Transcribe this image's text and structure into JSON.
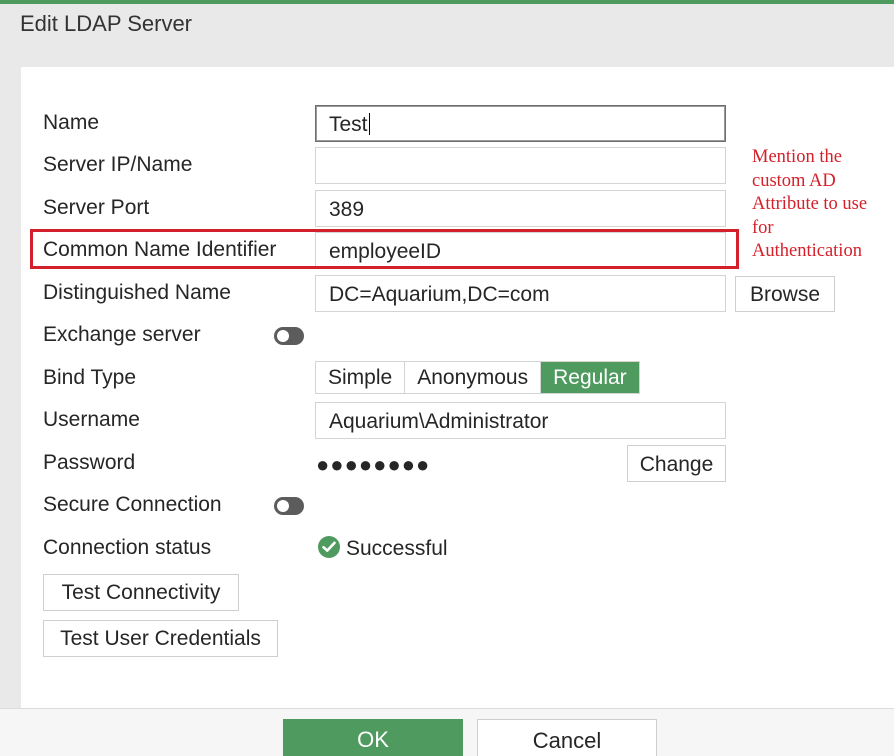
{
  "dialog": {
    "title": "Edit LDAP Server"
  },
  "fields": {
    "name": {
      "label": "Name",
      "value": "Test"
    },
    "server_ip": {
      "label": "Server IP/Name",
      "value": ""
    },
    "server_port": {
      "label": "Server Port",
      "value": "389"
    },
    "common_name": {
      "label": "Common Name Identifier",
      "value": "employeeID"
    },
    "distinguished_name": {
      "label": "Distinguished Name",
      "value": "DC=Aquarium,DC=com",
      "browse_label": "Browse"
    },
    "exchange_server": {
      "label": "Exchange server",
      "enabled": false
    },
    "bind_type": {
      "label": "Bind Type",
      "options": [
        "Simple",
        "Anonymous",
        "Regular"
      ],
      "selected": "Regular"
    },
    "username": {
      "label": "Username",
      "value": "Aquarium\\Administrator"
    },
    "password": {
      "label": "Password",
      "masked": "●●●●●●●●",
      "change_label": "Change"
    },
    "secure_connection": {
      "label": "Secure Connection",
      "enabled": false
    },
    "connection_status": {
      "label": "Connection status",
      "value": "Successful"
    }
  },
  "buttons": {
    "test_connectivity": "Test Connectivity",
    "test_user_credentials": "Test User Credentials",
    "ok": "OK",
    "cancel": "Cancel"
  },
  "annotation": {
    "lines": [
      "Mention the",
      "custom AD",
      "Attribute to use",
      "for",
      "Authentication"
    ]
  },
  "colors": {
    "accent": "#4f9a5e",
    "annotation": "#d4202a"
  }
}
